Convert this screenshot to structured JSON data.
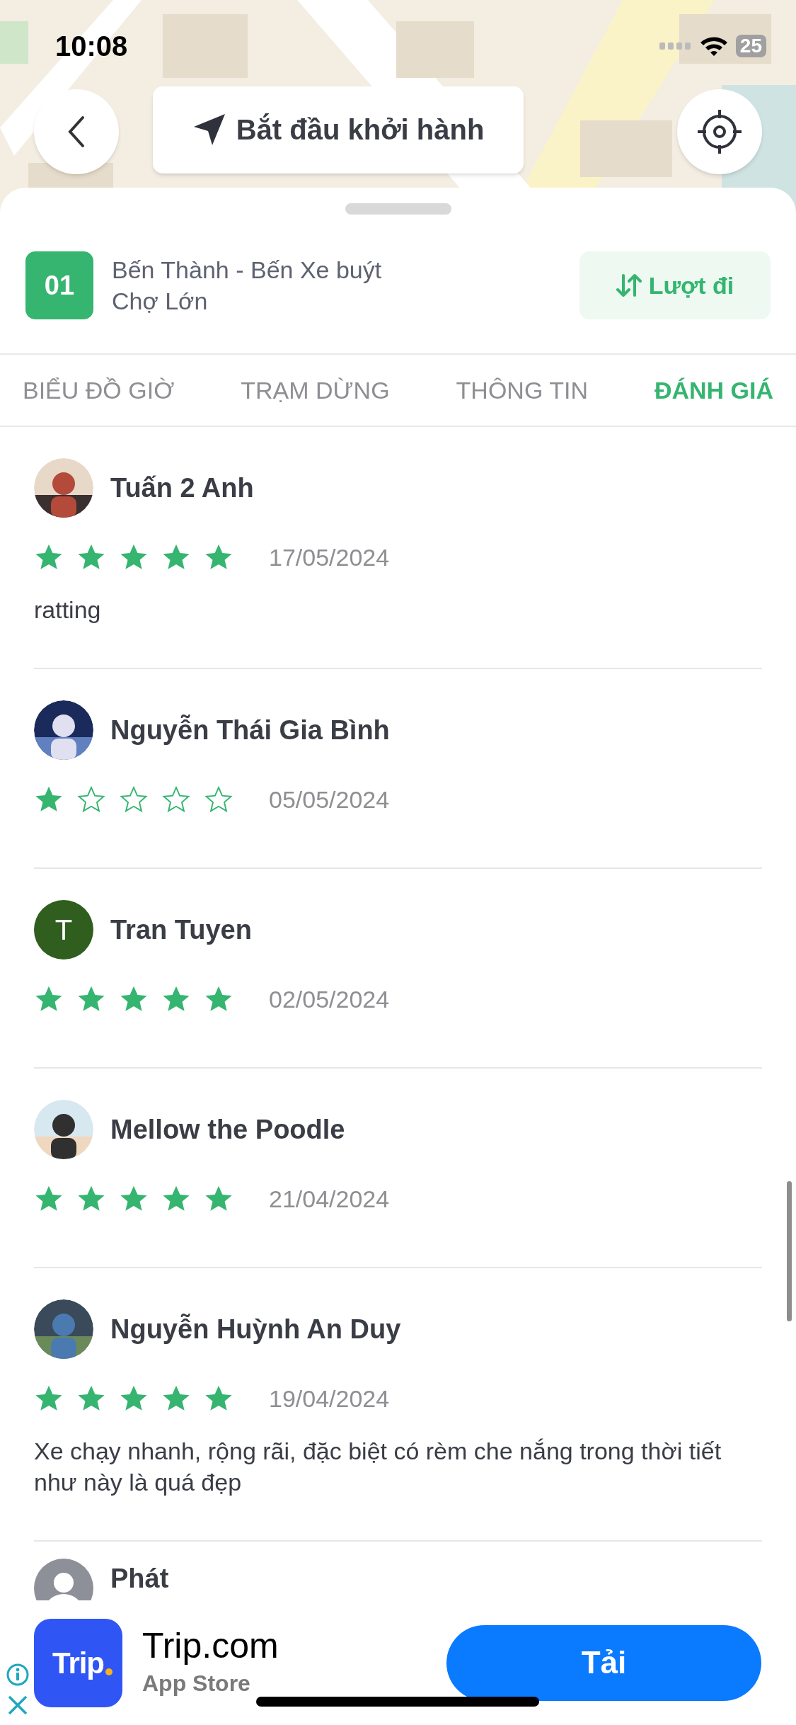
{
  "status_bar": {
    "time": "10:08",
    "battery": "25"
  },
  "top_buttons": {
    "start": "Bắt đầu khởi hành"
  },
  "route": {
    "number": "01",
    "name": "Bến Thành - Bến Xe buýt Chợ Lớn",
    "direction": "Lượt đi"
  },
  "tabs": [
    {
      "label": "BIỂU ĐỒ GIỜ",
      "selected": false
    },
    {
      "label": "TRẠM DỪNG",
      "selected": false
    },
    {
      "label": "THÔNG TIN",
      "selected": false
    },
    {
      "label": "ĐÁNH GIÁ",
      "selected": true
    }
  ],
  "reviews": [
    {
      "name": "Tuấn 2 Anh",
      "stars": 5,
      "date": "17/05/2024",
      "comment": "ratting"
    },
    {
      "name": "Nguyễn Thái Gia Bình",
      "stars": 1,
      "date": "05/05/2024"
    },
    {
      "avatar": {
        "kind": "letter",
        "letter": "T",
        "color": "#2f5e1e"
      },
      "name": "Tran Tuyen",
      "stars": 5,
      "date": "02/05/2024"
    },
    {
      "name": "Mellow the Poodle",
      "stars": 5,
      "date": "21/04/2024"
    },
    {
      "name": "Nguyễn Huỳnh An Duy",
      "stars": 5,
      "date": "19/04/2024",
      "comment": "Xe chạy nhanh, rộng rãi, đặc biệt có rèm che nắng trong thời tiết như này là quá đẹp"
    },
    {
      "avatar": {
        "kind": "silhouette"
      },
      "name": "Phát"
    }
  ],
  "ad": {
    "icon_text": "Trip",
    "app_name": "Trip.com",
    "store": "App Store",
    "button": "Tải"
  }
}
